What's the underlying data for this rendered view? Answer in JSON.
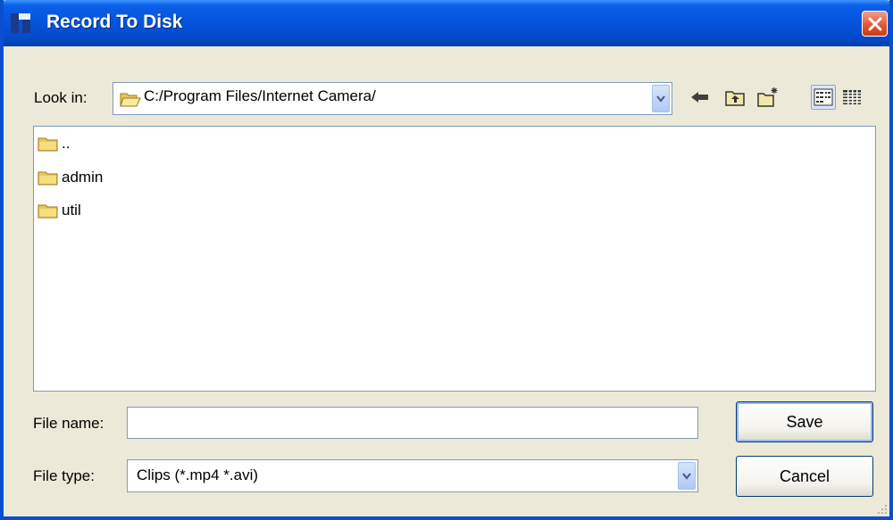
{
  "window": {
    "title": "Record To Disk"
  },
  "look_in": {
    "label": "Look in:",
    "path": "C:/Program Files/Internet Camera/"
  },
  "toolbar": {
    "icons": [
      "back-arrow-icon",
      "up-folder-icon",
      "new-folder-icon",
      "list-view-icon",
      "detail-view-icon"
    ]
  },
  "files": [
    {
      "name": ".."
    },
    {
      "name": "admin"
    },
    {
      "name": "util"
    }
  ],
  "file_name": {
    "label": "File name:",
    "value": ""
  },
  "file_type": {
    "label": "File type:",
    "value": "Clips (*.mp4 *.avi)"
  },
  "buttons": {
    "save": "Save",
    "cancel": "Cancel"
  },
  "colors": {
    "title_bar": "#0553dd",
    "dialog_bg": "#ece9d8",
    "close_button": "#e0542e",
    "border": "#7f9db9"
  }
}
